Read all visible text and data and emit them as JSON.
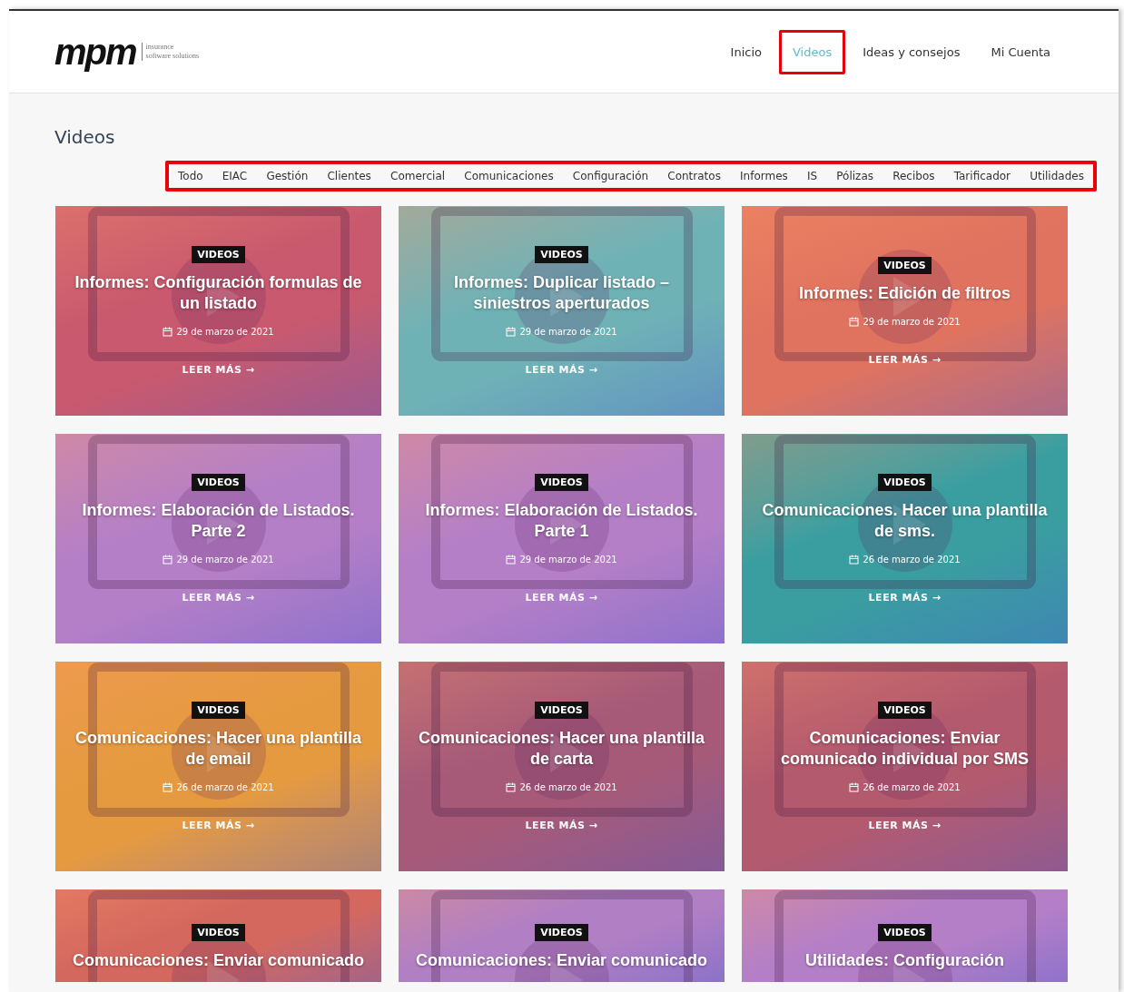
{
  "header": {
    "logo": {
      "mark": "mpm",
      "tagline_1": "insurance",
      "tagline_2": "software solutions"
    },
    "nav": [
      {
        "label": "Inicio",
        "selected": false,
        "highlighted": false
      },
      {
        "label": "Videos",
        "selected": true,
        "highlighted": true
      },
      {
        "label": "Ideas y consejos",
        "selected": false,
        "highlighted": false
      },
      {
        "label": "Mi Cuenta",
        "selected": false,
        "highlighted": false
      }
    ]
  },
  "page_title": "Videos",
  "filters": {
    "highlighted": true,
    "items": [
      {
        "label": "Todo"
      },
      {
        "label": "EIAC"
      },
      {
        "label": "Gestión"
      },
      {
        "label": "Clientes"
      },
      {
        "label": "Comercial"
      },
      {
        "label": "Comunicaciones"
      },
      {
        "label": "Configuración"
      },
      {
        "label": "Contratos"
      },
      {
        "label": "Informes"
      },
      {
        "label": "IS"
      },
      {
        "label": "Pólizas"
      },
      {
        "label": "Recibos"
      },
      {
        "label": "Tarificador"
      },
      {
        "label": "Utilidades"
      }
    ]
  },
  "cards": [
    {
      "badge": "VIDEOS",
      "title": "Informes: Configuración formulas de un listado",
      "date": "29 de marzo de 2021",
      "link": "LEER MÁS →",
      "color": "#c8596e"
    },
    {
      "badge": "VIDEOS",
      "title": "Informes: Duplicar listado – siniestros aperturados",
      "date": "29 de marzo de 2021",
      "link": "LEER MÁS →",
      "color": "#6fb2b6"
    },
    {
      "badge": "VIDEOS",
      "title": "Informes: Edición de filtros",
      "date": "29 de marzo de 2021",
      "link": "LEER MÁS →",
      "color": "#e0735f"
    },
    {
      "badge": "VIDEOS",
      "title": "Informes: Elaboración de Listados. Parte 2",
      "date": "29 de marzo de 2021",
      "link": "LEER MÁS →",
      "color": "#b47fc7"
    },
    {
      "badge": "VIDEOS",
      "title": "Informes: Elaboración de Listados. Parte 1",
      "date": "29 de marzo de 2021",
      "link": "LEER MÁS →",
      "color": "#b47fc7"
    },
    {
      "badge": "VIDEOS",
      "title": "Comunicaciones. Hacer una plantilla de sms.",
      "date": "26 de marzo de 2021",
      "link": "LEER MÁS →",
      "color": "#3a9ea0"
    },
    {
      "badge": "VIDEOS",
      "title": "Comunicaciones: Hacer una plantilla de email",
      "date": "26 de marzo de 2021",
      "link": "LEER MÁS →",
      "color": "#e59a40"
    },
    {
      "badge": "VIDEOS",
      "title": "Comunicaciones: Hacer una plantilla de carta",
      "date": "26 de marzo de 2021",
      "link": "LEER MÁS →",
      "color": "#a65a78"
    },
    {
      "badge": "VIDEOS",
      "title": "Comunicaciones: Enviar comunicado individual por SMS",
      "date": "26 de marzo de 2021",
      "link": "LEER MÁS →",
      "color": "#b45a6e"
    },
    {
      "badge": "VIDEOS",
      "title": "Comunicaciones: Enviar comunicado",
      "color": "#d4685f"
    },
    {
      "badge": "VIDEOS",
      "title": "Comunicaciones: Enviar comunicado",
      "color": "#b07fc4"
    },
    {
      "badge": "VIDEOS",
      "title": "Utilidades: Configuración",
      "color": "#b47fc7"
    }
  ]
}
